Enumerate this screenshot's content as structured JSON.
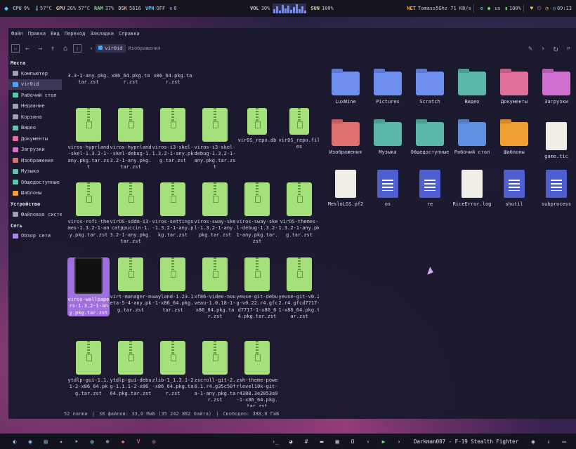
{
  "topbar": {
    "cpu_label": "CPU",
    "cpu_val": "9%",
    "cpu_temp": "57°C",
    "gpu_label": "GPU",
    "gpu_val": "26%",
    "gpu_temp": "57°C",
    "ram_label": "RAM",
    "ram_val": "37%",
    "dsk_label": "DSK",
    "dsk_val": "5616",
    "vpn_label": "VPN",
    "vpn_val": "OFF",
    "sync_count": "0",
    "vol_label": "VOL",
    "vol_val": "30%",
    "sun_label": "SUN",
    "sun_val": "100%",
    "net_label": "NET",
    "net_val": "Tomass5Ghz 71 KB/s",
    "kb_layout": "us",
    "battery": "100%",
    "clock": "09:13"
  },
  "menu": [
    "Файл",
    "Правка",
    "Вид",
    "Переход",
    "Закладки",
    "Справка"
  ],
  "path": {
    "current": "vir0id",
    "child": "Изображения"
  },
  "sidebar": {
    "places_header": "Места",
    "places": [
      {
        "label": "Компьютер",
        "color": "#9aa0b6"
      },
      {
        "label": "vir0id",
        "color": "#3fa7ff"
      },
      {
        "label": "Рабочий стол",
        "color": "#5ac8a8"
      },
      {
        "label": "Недавние",
        "color": "#9aa0b6"
      },
      {
        "label": "Корзина",
        "color": "#9aa0b6"
      },
      {
        "label": "Видео",
        "color": "#5ac8a8"
      },
      {
        "label": "Документы",
        "color": "#e0709a"
      },
      {
        "label": "Загрузки",
        "color": "#d070d0"
      },
      {
        "label": "Изображения",
        "color": "#e07070"
      },
      {
        "label": "Музыка",
        "color": "#5ac8a8"
      },
      {
        "label": "Общедоступные",
        "color": "#5ac8a8"
      },
      {
        "label": "Шаблоны",
        "color": "#f0a030"
      }
    ],
    "devices_header": "Устройства",
    "devices": [
      {
        "label": "Файловая систе...",
        "color": "#9aa0b6"
      }
    ],
    "network_header": "Сеть",
    "network": [
      {
        "label": "Обзор сети",
        "color": "#b080ff"
      }
    ]
  },
  "left_files": [
    {
      "name": "3.3-1-any.pkg.tar.zst",
      "type": "zip"
    },
    {
      "name": "x86_64.pkg.tar.zst",
      "type": "zip"
    },
    {
      "name": "x86_64.pkg.tar.zst",
      "type": "zip"
    },
    {
      "name": "viros-hyprland-skel-1.3.2-1-any.pkg.tar.zst",
      "type": "zip"
    },
    {
      "name": "viros-hyprland-skel-debug-1.3.2-1-any.pkg.tar.zst",
      "type": "zip"
    },
    {
      "name": "viros-i3-skel-1.3.2-1-any.pkg.tar.zst",
      "type": "zip"
    },
    {
      "name": "viros-i3-skel-debug-1.3.2-1-any.pkg.tar.zst",
      "type": "zip"
    },
    {
      "name": "virOS_repo.db",
      "type": "zip"
    },
    {
      "name": "virOS_repo.files",
      "type": "zip"
    },
    {
      "name": "viros-rofi-themes-1.3.2-1-any.pkg.tar.zst",
      "type": "zip"
    },
    {
      "name": "virOS-sddm-i3-catppuccin-1.3.2-1-any.pkg.tar.zst",
      "type": "zip"
    },
    {
      "name": "viros-settings-1.3.2-1-any.pkg.tar.zst",
      "type": "zip"
    },
    {
      "name": "viros-sway-skel-1.3.2-1-any.pkg.tar.zst",
      "type": "zip"
    },
    {
      "name": "viros-sway-skel-debug-1.3.2-1-any.pkg.tar.zst",
      "type": "zip"
    },
    {
      "name": "virOS-themes-1.3.2-1-any.pkg.tar.zst",
      "type": "zip"
    },
    {
      "name": "viros-wallpapers-1.3.2-1-any.pkg.tar.zst",
      "type": "dark"
    },
    {
      "name": "virt-manager-meta-5-4-any.pkg.tar.zst",
      "type": "zip"
    },
    {
      "name": "wayland-1.23.1-1-x86_64.pkg.tar.zst",
      "type": "zip"
    },
    {
      "name": "xf86-video-nouveau-1.0.18-1-x86_64.pkg.tar.zst",
      "type": "zip"
    },
    {
      "name": "yeuse-git-debug-v0.22.r4.gfcd7717-1-x86_64.pkg.tar.zst",
      "type": "zip"
    },
    {
      "name": "yeuse-git-v0.22.r4.gfcd7717-1-x86_64.pkg.tar.zst",
      "type": "zip"
    },
    {
      "name": "ytdlp-gui-1.1.1-2-x86_64.pkg.tar.zst",
      "type": "zip"
    },
    {
      "name": "ytdlp-gui-debug-1.1.1-2-x86_64.pkg.tar.zst",
      "type": "zip"
    },
    {
      "name": "zlib-1_1.3.1-2-x86_64.pkg.tar.zst",
      "type": "zip"
    },
    {
      "name": "zscroll-git-2.0.1.r4.g35c50fa-1-any.pkg.tar.zst",
      "type": "zip"
    },
    {
      "name": "zsh-theme-powerlevel10k-git-r4388.3e2053a9-1-x86_64.pkg.tar.zst",
      "type": "zip"
    }
  ],
  "right_items": [
    {
      "name": "LuxWine",
      "kind": "folder",
      "color": "#6f8ff0"
    },
    {
      "name": "Pictures",
      "kind": "folder",
      "color": "#6f8ff0"
    },
    {
      "name": "Scratch",
      "kind": "folder",
      "color": "#6f8ff0"
    },
    {
      "name": "Видео",
      "kind": "folder",
      "color": "#5ab8a8"
    },
    {
      "name": "Документы",
      "kind": "folder",
      "color": "#e0709a"
    },
    {
      "name": "Загрузки",
      "kind": "folder",
      "color": "#d070d0"
    },
    {
      "name": "Изображения",
      "kind": "folder",
      "color": "#e07070"
    },
    {
      "name": "Музыка",
      "kind": "folder",
      "color": "#5ab8a8"
    },
    {
      "name": "Общедоступные",
      "kind": "folder",
      "color": "#5ab8a8"
    },
    {
      "name": "Рабочий стол",
      "kind": "folder",
      "color": "#6090e0"
    },
    {
      "name": "Шаблоны",
      "kind": "folder",
      "color": "#f0a030"
    },
    {
      "name": "game.tic",
      "kind": "doc",
      "color": "#f0ece6"
    },
    {
      "name": "MesloLGS.pf2",
      "kind": "doc",
      "color": "#f0ece6"
    },
    {
      "name": "os",
      "kind": "doc",
      "color": "#4f5fd0"
    },
    {
      "name": "re",
      "kind": "doc",
      "color": "#4f5fd0"
    },
    {
      "name": "RiceError.log",
      "kind": "doc",
      "color": "#f0ece6"
    },
    {
      "name": "shutil",
      "kind": "doc",
      "color": "#4f5fd0"
    },
    {
      "name": "subprocess",
      "kind": "doc",
      "color": "#4f5fd0"
    }
  ],
  "status": {
    "folders": "52 папки",
    "files": "38 файлов: 33,0 МиБ (35 242 882 байта)",
    "free": "Свободно: 388,8 ГиБ"
  },
  "taskbar": {
    "now_playing": "Darkman007 - F-19 Stealth Fighter"
  }
}
